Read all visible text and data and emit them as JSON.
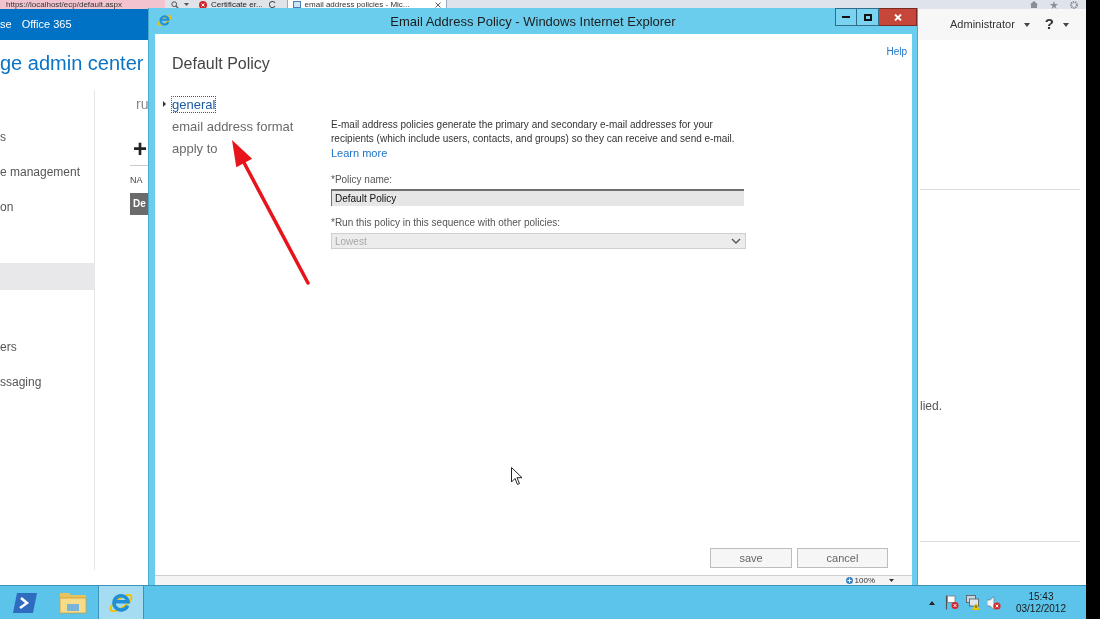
{
  "browser_strip": {
    "address": "https://localhost/ecp/default.aspx",
    "security_label": "Certificate er...",
    "tabs": [
      {
        "label": "email address policies - Mic...",
        "selected": true
      }
    ]
  },
  "top_bar": {
    "links": [
      "se",
      "Office 365"
    ],
    "user": "Administrator",
    "help": "?"
  },
  "background_page": {
    "title": "ge admin center",
    "nav_items": [
      {
        "label": "s",
        "selected": false
      },
      {
        "label": "e management",
        "selected": false
      },
      {
        "label": "on",
        "selected": false
      },
      {
        "selected": true
      },
      {
        "label": "ers",
        "selected": false
      },
      {
        "label": "ssaging",
        "selected": false
      }
    ],
    "list_header": "ru",
    "add_button": "+",
    "column_header": "NA",
    "rows": [
      {
        "label": "De",
        "selected": true
      }
    ],
    "right_text": "lied."
  },
  "dialog": {
    "window_title": "Email Address Policy - Windows Internet Explorer",
    "heading": "Default Policy",
    "help_link": "Help",
    "sections": [
      {
        "label": "general",
        "selected": true
      },
      {
        "label": "email address format",
        "selected": false
      },
      {
        "label": "apply to",
        "selected": false
      }
    ],
    "description": "E-mail address policies generate the primary and secondary e-mail addresses for your recipients (which include users, contacts, and groups) so they can receive and send e-mail.",
    "learn_more": "Learn more",
    "fields": [
      {
        "kind": "text",
        "label": "*Policy name:",
        "value": "Default Policy",
        "disabled": false
      },
      {
        "kind": "select",
        "label": "*Run this policy in this sequence with other policies:",
        "value": "Lowest",
        "disabled": true
      }
    ],
    "buttons": [
      "save",
      "cancel"
    ],
    "zoom": "100%"
  },
  "taskbar": {
    "apps": [
      {
        "kind": "terminal",
        "selected": false
      },
      {
        "kind": "folder",
        "selected": false
      },
      {
        "kind": "browser",
        "selected": true
      }
    ],
    "clock": {
      "time": "15:43",
      "date": "03/12/2012"
    }
  }
}
